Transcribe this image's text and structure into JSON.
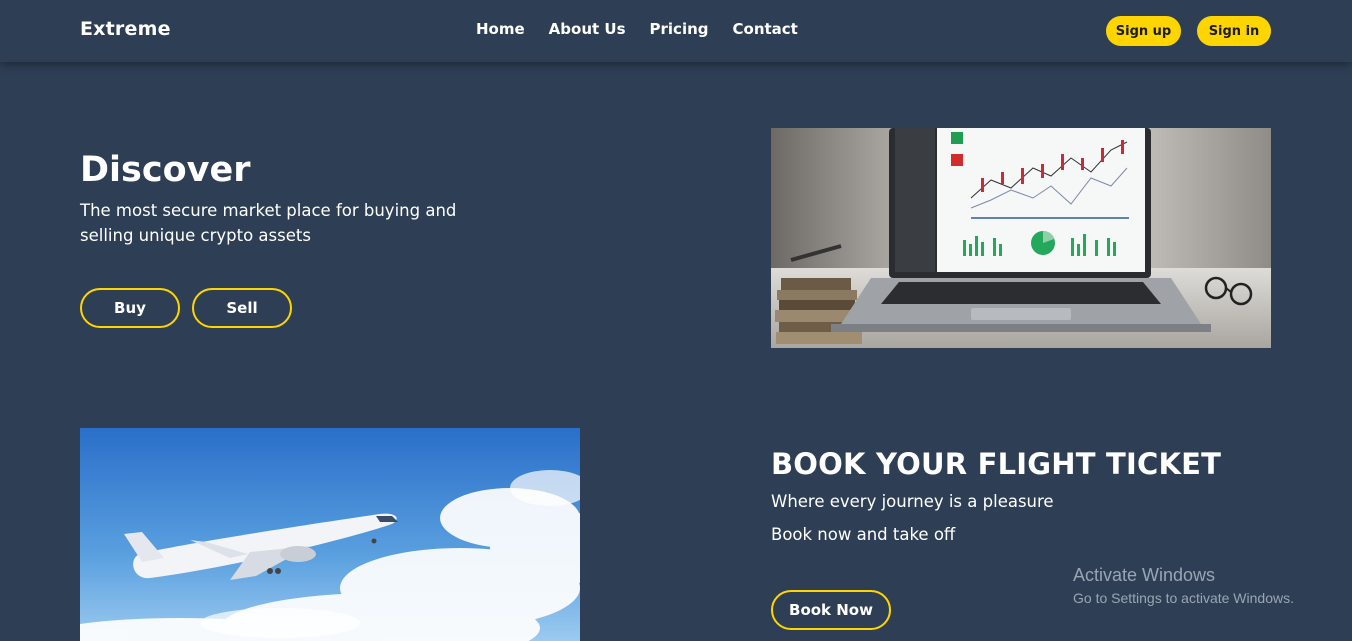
{
  "nav": {
    "brand": "Extreme",
    "links": [
      "Home",
      "About Us",
      "Pricing",
      "Contact"
    ],
    "signup": "Sign up",
    "signin": "Sign in"
  },
  "hero": {
    "title": "Discover",
    "subtitle": "The most secure market place for buying and selling unique crypto assets",
    "buy": "Buy",
    "sell": "Sell"
  },
  "flight": {
    "title": "BOOK YOUR FLIGHT TICKET",
    "line1": "Where every journey is a pleasure",
    "line2": "Book now and take off",
    "button": "Book Now"
  },
  "watermark": {
    "title": "Activate Windows",
    "subtitle": "Go to Settings to activate Windows."
  },
  "colors": {
    "background": "#2e3f55",
    "accent": "#ffd500"
  }
}
